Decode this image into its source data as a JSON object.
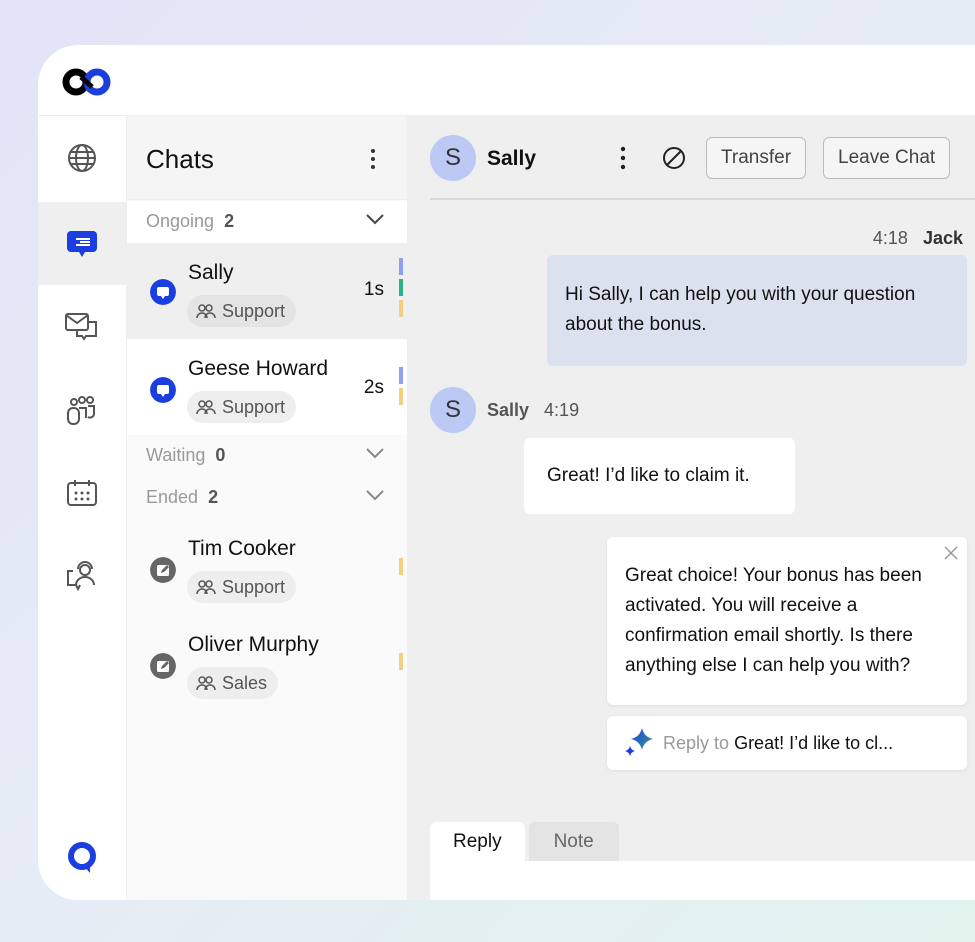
{
  "app": {
    "logo": "brand-logo"
  },
  "nav": {
    "items": [
      {
        "name": "globe",
        "icon": "globe-icon"
      },
      {
        "name": "chats",
        "icon": "chat-icon",
        "active": true
      },
      {
        "name": "messages",
        "icon": "mail-chat-icon"
      },
      {
        "name": "teams",
        "icon": "team-icon"
      },
      {
        "name": "calendar",
        "icon": "calendar-icon"
      },
      {
        "name": "agent",
        "icon": "agent-support-icon"
      }
    ]
  },
  "list": {
    "title": "Chats",
    "sections": {
      "ongoing": {
        "label": "Ongoing",
        "count": "2"
      },
      "waiting": {
        "label": "Waiting",
        "count": "0"
      },
      "ended": {
        "label": "Ended",
        "count": "2"
      }
    },
    "chats": [
      {
        "name": "Sally",
        "tag": "Support",
        "time": "1s",
        "status": "ongoing",
        "bars": [
          "#8fa0f2",
          "#2bb38a",
          "#f5cf80"
        ]
      },
      {
        "name": "Geese Howard",
        "tag": "Support",
        "time": "2s",
        "status": "ongoing",
        "bars": [
          "#8fa0f2",
          "#f5cf80"
        ]
      },
      {
        "name": "Tim Cooker",
        "tag": "Support",
        "time": "",
        "status": "ended",
        "bars": [
          "#f5cf80"
        ]
      },
      {
        "name": "Oliver Murphy",
        "tag": "Sales",
        "time": "",
        "status": "ended",
        "bars": [
          "#f5cf80"
        ]
      }
    ]
  },
  "chat": {
    "contact": {
      "initial": "S",
      "name": "Sally"
    },
    "transfer_label": "Transfer",
    "leave_label": "Leave Chat",
    "messages": [
      {
        "time": "4:18",
        "author": "Jack",
        "text": "Hi Sally, I can help you with your question about the bonus."
      },
      {
        "initial": "S",
        "author": "Sally",
        "time": "4:19",
        "text": "Great! I’d like to claim it."
      }
    ],
    "suggestion": {
      "text": "Great choice! Your bonus has been activated. You will receive a confirmation email shortly. Is there anything else I can help you with?",
      "reply_prefix": "Reply to",
      "reply_target": "Great! I’d like to cl..."
    },
    "tabs": [
      {
        "label": "Reply",
        "active": true
      },
      {
        "label": "Note",
        "active": false
      }
    ]
  },
  "colors": {
    "accent": "#1a3ee0",
    "avatar": "#bcc9f5",
    "agent_bubble": "#dce1f0"
  }
}
